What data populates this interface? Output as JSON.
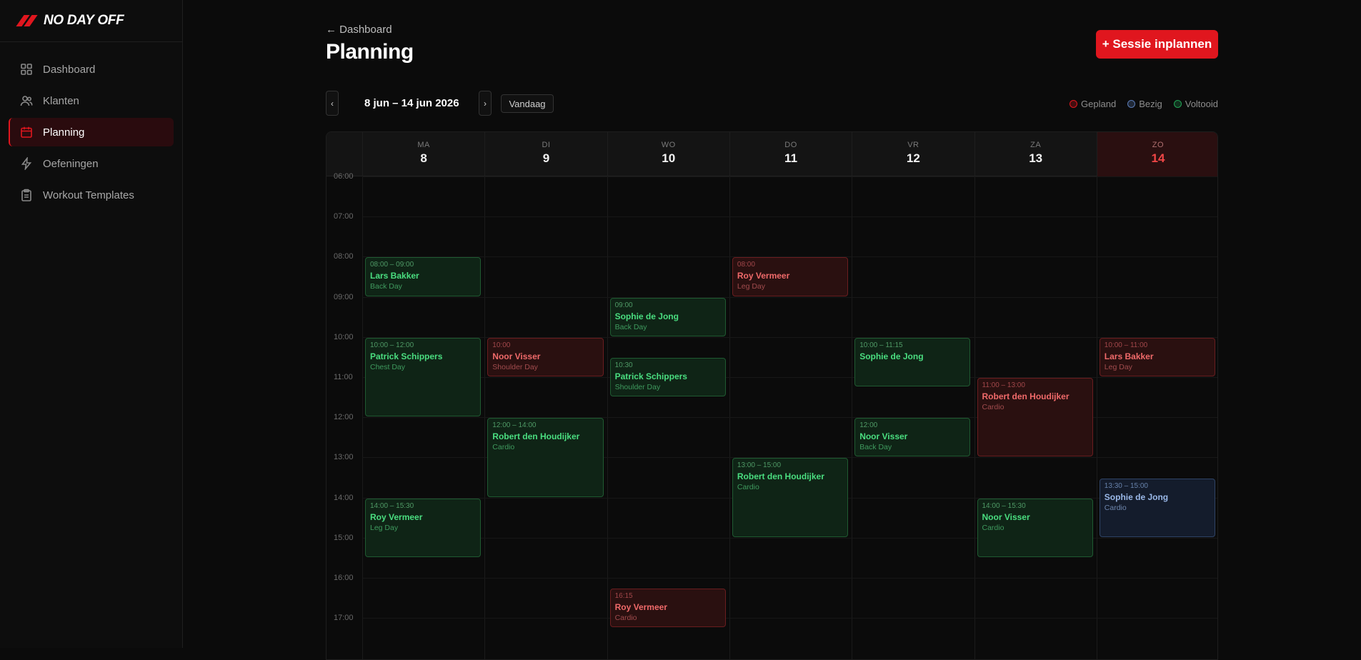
{
  "brand": {
    "name": "NO DAY OFF",
    "accent": "#e0161e"
  },
  "sidebar": {
    "items": [
      {
        "label": "Dashboard",
        "icon": "grid-icon",
        "active": false
      },
      {
        "label": "Klanten",
        "icon": "users-icon",
        "active": false
      },
      {
        "label": "Planning",
        "icon": "calendar-icon",
        "active": true
      },
      {
        "label": "Oefeningen",
        "icon": "lightning-icon",
        "active": false
      },
      {
        "label": "Workout Templates",
        "icon": "clipboard-icon",
        "active": false
      }
    ]
  },
  "header": {
    "back_label": "← Dashboard",
    "title": "Planning",
    "new_session_label": "+ Sessie inplannen"
  },
  "toolbar": {
    "prev_label": "‹",
    "next_label": "›",
    "date_range": "8 jun – 14 jun 2026",
    "today_label": "Vandaag"
  },
  "legend": [
    {
      "label": "Gepland",
      "color": "#e0161e"
    },
    {
      "label": "Bezig",
      "color": "#5b7bb5"
    },
    {
      "label": "Voltooid",
      "color": "#22a355"
    }
  ],
  "calendar": {
    "days": [
      {
        "dow": "MA",
        "num": "8"
      },
      {
        "dow": "DI",
        "num": "9"
      },
      {
        "dow": "WO",
        "num": "10"
      },
      {
        "dow": "DO",
        "num": "11"
      },
      {
        "dow": "VR",
        "num": "12"
      },
      {
        "dow": "ZA",
        "num": "13"
      },
      {
        "dow": "ZO",
        "num": "14",
        "today": true
      }
    ],
    "hours": [
      "06:00",
      "07:00",
      "08:00",
      "09:00",
      "10:00",
      "11:00",
      "12:00",
      "13:00",
      "14:00",
      "15:00",
      "16:00",
      "17:00"
    ],
    "events": [
      {
        "day": 0,
        "start": 8.0,
        "end": 9.0,
        "time": "08:00 – 09:00",
        "name": "Lars Bakker",
        "workout": "Back Day",
        "status": "done"
      },
      {
        "day": 0,
        "start": 10.0,
        "end": 12.0,
        "time": "10:00 – 12:00",
        "name": "Patrick Schippers",
        "workout": "Chest Day",
        "status": "done"
      },
      {
        "day": 0,
        "start": 14.0,
        "end": 15.5,
        "time": "14:00 – 15:30",
        "name": "Roy Vermeer",
        "workout": "Leg Day",
        "status": "done"
      },
      {
        "day": 1,
        "start": 10.0,
        "end": 11.0,
        "time": "10:00",
        "name": "Noor Visser",
        "workout": "Shoulder Day",
        "status": "planned"
      },
      {
        "day": 1,
        "start": 12.0,
        "end": 14.0,
        "time": "12:00 – 14:00",
        "name": "Robert den Houdijker",
        "workout": "Cardio",
        "status": "done"
      },
      {
        "day": 2,
        "start": 9.0,
        "end": 10.0,
        "time": "09:00",
        "name": "Sophie de Jong",
        "workout": "Back Day",
        "status": "done"
      },
      {
        "day": 2,
        "start": 10.5,
        "end": 11.5,
        "time": "10:30",
        "name": "Patrick Schippers",
        "workout": "Shoulder Day",
        "status": "done"
      },
      {
        "day": 2,
        "start": 16.25,
        "end": 17.25,
        "time": "16:15",
        "name": "Roy Vermeer",
        "workout": "Cardio",
        "status": "planned"
      },
      {
        "day": 3,
        "start": 8.0,
        "end": 9.0,
        "time": "08:00",
        "name": "Roy Vermeer",
        "workout": "Leg Day",
        "status": "planned"
      },
      {
        "day": 3,
        "start": 13.0,
        "end": 15.0,
        "time": "13:00 – 15:00",
        "name": "Robert den Houdijker",
        "workout": "Cardio",
        "status": "done"
      },
      {
        "day": 4,
        "start": 10.0,
        "end": 11.25,
        "time": "10:00 – 11:15",
        "name": "Sophie de Jong",
        "workout": "",
        "status": "done"
      },
      {
        "day": 4,
        "start": 12.0,
        "end": 13.0,
        "time": "12:00",
        "name": "Noor Visser",
        "workout": "Back Day",
        "status": "done"
      },
      {
        "day": 5,
        "start": 11.0,
        "end": 13.0,
        "time": "11:00 – 13:00",
        "name": "Robert den Houdijker",
        "workout": "Cardio",
        "status": "planned"
      },
      {
        "day": 5,
        "start": 14.0,
        "end": 15.5,
        "time": "14:00 – 15:30",
        "name": "Noor Visser",
        "workout": "Cardio",
        "status": "done"
      },
      {
        "day": 6,
        "start": 10.0,
        "end": 11.0,
        "time": "10:00 – 11:00",
        "name": "Lars Bakker",
        "workout": "Leg Day",
        "status": "planned"
      },
      {
        "day": 6,
        "start": 13.5,
        "end": 15.0,
        "time": "13:30 – 15:00",
        "name": "Sophie de Jong",
        "workout": "Cardio",
        "status": "busy"
      }
    ]
  }
}
